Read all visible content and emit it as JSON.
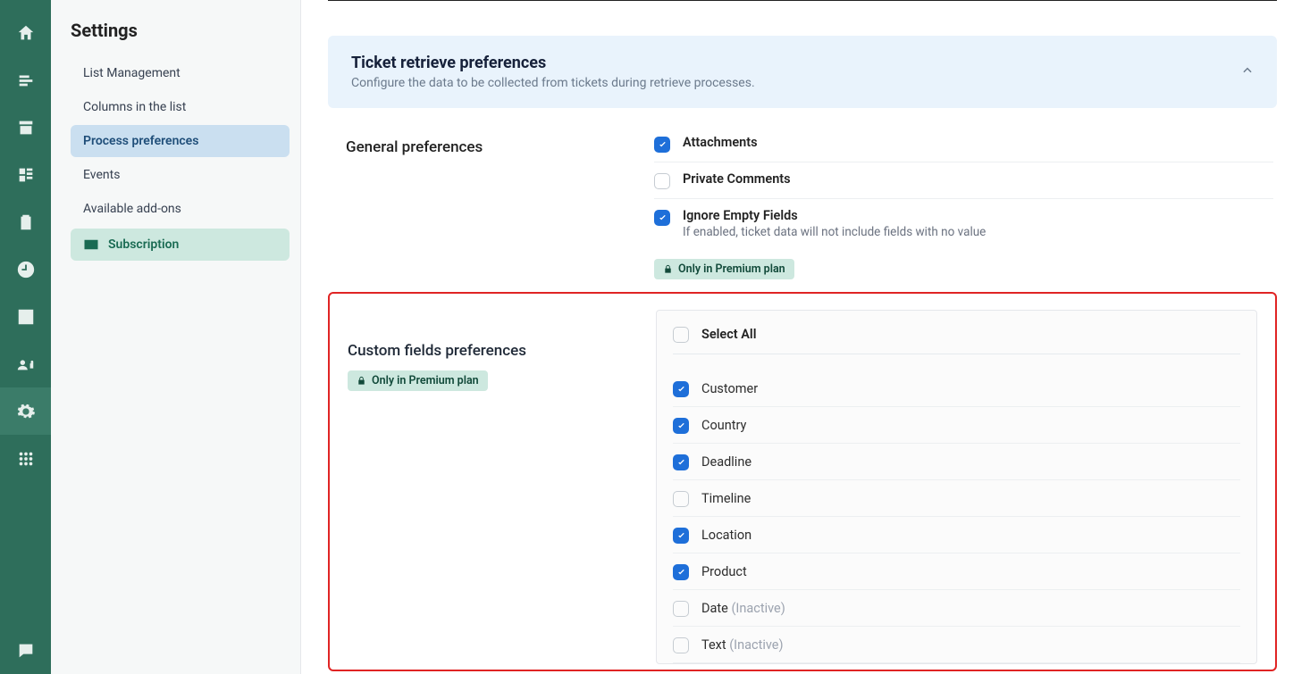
{
  "sidebar": {
    "title": "Settings",
    "items": [
      {
        "label": "List Management"
      },
      {
        "label": "Columns in the list"
      },
      {
        "label": "Process preferences"
      },
      {
        "label": "Events"
      },
      {
        "label": "Available add-ons"
      }
    ],
    "subscription_label": "Subscription"
  },
  "panel": {
    "title": "Ticket retrieve preferences",
    "subtitle": "Configure the data to be collected from tickets during retrieve processes."
  },
  "general": {
    "title": "General preferences",
    "attachments_label": "Attachments",
    "private_comments_label": "Private Comments",
    "ignore_empty_label": "Ignore Empty Fields",
    "ignore_empty_desc": "If enabled, ticket data will not include fields with no value",
    "premium_badge": "Only in Premium plan"
  },
  "custom": {
    "title": "Custom fields preferences",
    "premium_badge": "Only in Premium plan",
    "select_all_label": "Select All",
    "inactive_suffix": "(Inactive)",
    "fields": [
      {
        "label": "Customer",
        "checked": true,
        "inactive": false
      },
      {
        "label": "Country",
        "checked": true,
        "inactive": false
      },
      {
        "label": "Deadline",
        "checked": true,
        "inactive": false
      },
      {
        "label": "Timeline",
        "checked": false,
        "inactive": false
      },
      {
        "label": "Location",
        "checked": true,
        "inactive": false
      },
      {
        "label": "Product",
        "checked": true,
        "inactive": false
      },
      {
        "label": "Date",
        "checked": false,
        "inactive": true
      },
      {
        "label": "Text",
        "checked": false,
        "inactive": true
      }
    ]
  }
}
